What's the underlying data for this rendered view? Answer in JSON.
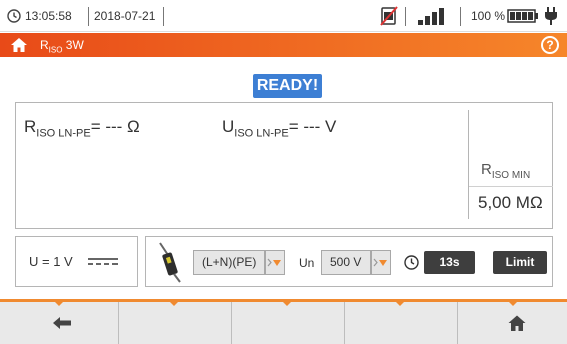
{
  "status": {
    "time": "13:05:58",
    "date": "2018-07-21",
    "battery_percent": "100 %",
    "icons": [
      "clock-icon",
      "no-sim-icon",
      "signal-bars-icon",
      "battery-icon",
      "power-plug-icon"
    ]
  },
  "titlebar": {
    "title_main": "R",
    "title_sub": "ISO",
    "title_suffix": " 3W",
    "help_label": "?"
  },
  "status_badge": "READY!",
  "measurement": {
    "riso_main": "R",
    "riso_sub": "ISO LN-PE",
    "riso_value": "= --- Ω",
    "uiso_main": "U",
    "uiso_sub": "ISO LN-PE",
    "uiso_value": "= --- V",
    "riso_min_main": "R",
    "riso_min_sub": "ISO MIN",
    "riso_min_value": "5,00 MΩ"
  },
  "voltage_box": {
    "label": "U = 1 V"
  },
  "settings": {
    "connection": "(L+N)(PE)",
    "un_label": "Un",
    "un_value": "500 V",
    "time_value": "13s",
    "limit_label": "Limit"
  },
  "colors": {
    "accent_orange": "#f08a30",
    "title_gradient_start": "#e84a18",
    "ready_blue": "#3d7fd4",
    "dark_button": "#3e3e3e"
  }
}
